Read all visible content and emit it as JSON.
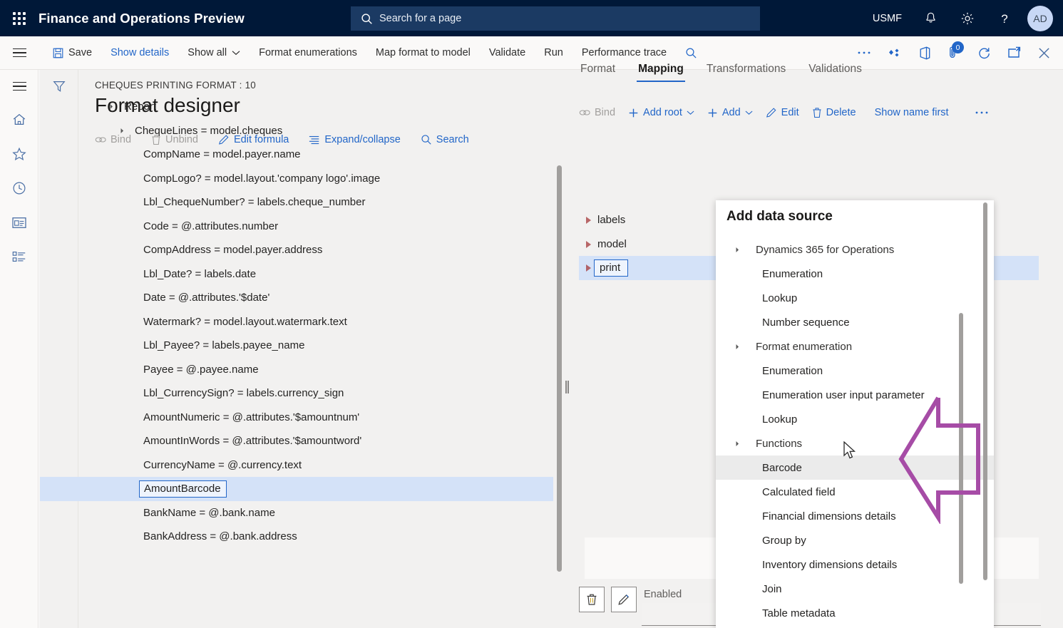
{
  "topbar": {
    "waffle_icon": "waffle-icon",
    "app_title": "Finance and Operations Preview",
    "search_placeholder": "Search for a page",
    "search_icon": "search-icon",
    "company": "USMF",
    "notification_icon": "bell-icon",
    "settings_icon": "gear-icon",
    "help_icon": "question-mark-icon",
    "avatar_initials": "AD"
  },
  "commandbar": {
    "menu_icon": "hamburger-icon",
    "items": [
      {
        "label": "Save",
        "icon": "save-icon",
        "kind": "normal"
      },
      {
        "label": "Show details",
        "icon": "",
        "kind": "link"
      },
      {
        "label": "Show all",
        "icon": "chevron-down-icon",
        "kind": "normal"
      },
      {
        "label": "Format enumerations",
        "icon": "",
        "kind": "normal"
      },
      {
        "label": "Map format to model",
        "icon": "",
        "kind": "normal"
      },
      {
        "label": "Validate",
        "icon": "",
        "kind": "normal"
      },
      {
        "label": "Run",
        "icon": "",
        "kind": "normal"
      },
      {
        "label": "Performance trace",
        "icon": "",
        "kind": "normal"
      }
    ],
    "search_icon": "search-icon",
    "right_icons": [
      "more-ellipsis-icon",
      "share-diamond-icon",
      "office-icon",
      "attachment-icon",
      "refresh-icon",
      "popout-icon",
      "close-icon"
    ],
    "attachment_badge": "0"
  },
  "rail": {
    "icons": [
      "hamburger-icon",
      "home-icon",
      "star-icon",
      "clock-icon",
      "workspace-icon",
      "modules-list-icon"
    ]
  },
  "page": {
    "filter_icon": "filter-icon",
    "caption": "CHEQUES PRINTING FORMAT : 10",
    "title": "Format designer",
    "actions": [
      {
        "label": "Bind",
        "icon": "link-icon",
        "disabled": true
      },
      {
        "label": "Unbind",
        "icon": "trash-icon",
        "disabled": true
      },
      {
        "label": "Edit formula",
        "icon": "pencil-icon",
        "disabled": false
      },
      {
        "label": "Expand/collapse",
        "icon": "list-icon",
        "disabled": false
      },
      {
        "label": "Search",
        "icon": "search-icon",
        "disabled": false
      }
    ]
  },
  "format_tree": {
    "rows": [
      {
        "label": "Report",
        "indent": 0,
        "expander": "expanded",
        "selected": false
      },
      {
        "label": "ChequeLines = model.cheques",
        "indent": 1,
        "expander": "expanded",
        "selected": false
      },
      {
        "label": "CompName = model.payer.name",
        "indent": 2,
        "expander": "none",
        "selected": false
      },
      {
        "label": "CompLogo? = model.layout.'company logo'.image",
        "indent": 2,
        "expander": "none",
        "selected": false
      },
      {
        "label": "Lbl_ChequeNumber? = labels.cheque_number",
        "indent": 2,
        "expander": "none",
        "selected": false
      },
      {
        "label": "Code = @.attributes.number",
        "indent": 2,
        "expander": "none",
        "selected": false
      },
      {
        "label": "CompAddress = model.payer.address",
        "indent": 2,
        "expander": "none",
        "selected": false
      },
      {
        "label": "Lbl_Date? = labels.date",
        "indent": 2,
        "expander": "none",
        "selected": false
      },
      {
        "label": "Date = @.attributes.'$date'",
        "indent": 2,
        "expander": "none",
        "selected": false
      },
      {
        "label": "Watermark? = model.layout.watermark.text",
        "indent": 2,
        "expander": "none",
        "selected": false
      },
      {
        "label": "Lbl_Payee? = labels.payee_name",
        "indent": 2,
        "expander": "none",
        "selected": false
      },
      {
        "label": "Payee = @.payee.name",
        "indent": 2,
        "expander": "none",
        "selected": false
      },
      {
        "label": "Lbl_CurrencySign? = labels.currency_sign",
        "indent": 2,
        "expander": "none",
        "selected": false
      },
      {
        "label": "AmountNumeric = @.attributes.'$amountnum'",
        "indent": 2,
        "expander": "none",
        "selected": false
      },
      {
        "label": "AmountInWords = @.attributes.'$amountword'",
        "indent": 2,
        "expander": "none",
        "selected": false
      },
      {
        "label": "CurrencyName = @.currency.text",
        "indent": 2,
        "expander": "none",
        "selected": false
      },
      {
        "label": "AmountBarcode",
        "indent": 2,
        "expander": "none",
        "selected": true
      },
      {
        "label": "BankName = @.bank.name",
        "indent": 2,
        "expander": "none",
        "selected": false
      },
      {
        "label": "BankAddress = @.bank.address",
        "indent": 2,
        "expander": "none",
        "selected": false
      }
    ]
  },
  "right_pane": {
    "tabs": [
      {
        "label": "Format",
        "active": false
      },
      {
        "label": "Mapping",
        "active": true
      },
      {
        "label": "Transformations",
        "active": false
      },
      {
        "label": "Validations",
        "active": false
      }
    ],
    "toolbar": [
      {
        "label": "Bind",
        "icon": "link-icon",
        "disabled": true,
        "chevron": false
      },
      {
        "label": "Add root",
        "icon": "plus-icon",
        "disabled": false,
        "chevron": true
      },
      {
        "label": "Add",
        "icon": "plus-icon",
        "disabled": false,
        "chevron": true
      },
      {
        "label": "Edit",
        "icon": "pencil-icon",
        "disabled": false,
        "chevron": false
      },
      {
        "label": "Delete",
        "icon": "trash-icon",
        "disabled": false,
        "chevron": false
      },
      {
        "label": "Show name first",
        "icon": "",
        "disabled": false,
        "chevron": false
      },
      {
        "label": "…",
        "icon": "more-ellipsis-icon",
        "disabled": false,
        "chevron": false
      }
    ],
    "rows": [
      {
        "label": "labels",
        "selected": false
      },
      {
        "label": "model",
        "selected": false
      },
      {
        "label": "print",
        "selected": true
      }
    ],
    "delete_icon": "trash-icon",
    "edit_icon": "pencil-icon",
    "enabled_label": "Enabled",
    "enabled_value": ""
  },
  "flyout": {
    "title": "Add data source",
    "items": [
      {
        "label": "Dynamics 365 for Operations",
        "type": "group",
        "highlighted": false
      },
      {
        "label": "Enumeration",
        "type": "item",
        "highlighted": false
      },
      {
        "label": "Lookup",
        "type": "item",
        "highlighted": false
      },
      {
        "label": "Number sequence",
        "type": "item",
        "highlighted": false
      },
      {
        "label": "Format enumeration",
        "type": "group",
        "highlighted": false
      },
      {
        "label": "Enumeration",
        "type": "item",
        "highlighted": false
      },
      {
        "label": "Enumeration user input parameter",
        "type": "item",
        "highlighted": false
      },
      {
        "label": "Lookup",
        "type": "item",
        "highlighted": false
      },
      {
        "label": "Functions",
        "type": "group",
        "highlighted": false
      },
      {
        "label": "Barcode",
        "type": "item",
        "highlighted": true
      },
      {
        "label": "Calculated field",
        "type": "item",
        "highlighted": false
      },
      {
        "label": "Financial dimensions details",
        "type": "item",
        "highlighted": false
      },
      {
        "label": "Group by",
        "type": "item",
        "highlighted": false
      },
      {
        "label": "Inventory dimensions details",
        "type": "item",
        "highlighted": false
      },
      {
        "label": "Join",
        "type": "item",
        "highlighted": false
      },
      {
        "label": "Table metadata",
        "type": "item",
        "highlighted": false
      }
    ]
  },
  "annotation": {
    "shape": "left-arrow-callout",
    "color": "#a64ca6",
    "cursor_icon": "mouse-pointer-icon"
  },
  "colors": {
    "nav_background": "#001838",
    "accent_link": "#2266c8",
    "selection": "#d4e2f8",
    "page_background": "#f2f1f0",
    "annotation": "#a64ca6"
  }
}
